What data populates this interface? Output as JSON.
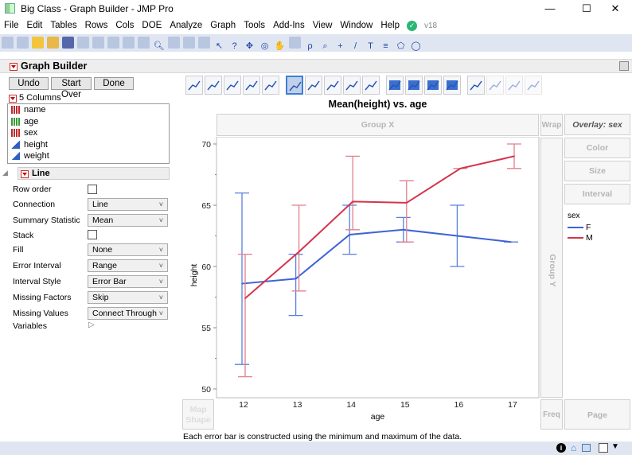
{
  "window": {
    "title": "Big Class - Graph Builder - JMP Pro",
    "minimize": "—",
    "maximize": "☐",
    "close": "✕"
  },
  "menu": [
    "File",
    "Edit",
    "Tables",
    "Rows",
    "Cols",
    "DOE",
    "Analyze",
    "Graph",
    "Tools",
    "Add-Ins",
    "View",
    "Window",
    "Help"
  ],
  "version": "v18",
  "toolbar_icons": [
    "new-table-icon",
    "new-script-icon",
    "python-icon",
    "open-icon",
    "save-icon",
    "cut-icon",
    "copy-icon",
    "paste-icon",
    "script-icon",
    "lock-icon",
    "search-icon",
    "data-grid-icon",
    "journal-icon",
    "add-icon",
    "arrow-icon",
    "help-icon",
    "crosshair-icon",
    "target-icon",
    "hand-icon",
    "brush-icon",
    "lasso-icon",
    "zoom-icon",
    "plus-icon",
    "line-icon",
    "text-icon",
    "annotate-icon",
    "polygon-icon",
    "oval-icon"
  ],
  "panel": {
    "title": "Graph Builder",
    "undo": "Undo",
    "start_over": "Start Over",
    "done": "Done",
    "columns_label": "5 Columns",
    "columns": [
      {
        "name": "name",
        "type": "nominal"
      },
      {
        "name": "age",
        "type": "ordinal"
      },
      {
        "name": "sex",
        "type": "nominal"
      },
      {
        "name": "height",
        "type": "continuous"
      },
      {
        "name": "weight",
        "type": "continuous"
      }
    ]
  },
  "line_section": {
    "title": "Line",
    "row_order": "Row order",
    "connection": "Connection",
    "connection_val": "Line",
    "summary": "Summary Statistic",
    "summary_val": "Mean",
    "stack": "Stack",
    "fill": "Fill",
    "fill_val": "None",
    "error_interval": "Error Interval",
    "error_interval_val": "Range",
    "interval_style": "Interval Style",
    "interval_style_val": "Error Bar",
    "missing_factors": "Missing Factors",
    "missing_factors_val": "Skip",
    "missing_values": "Missing Values",
    "missing_values_val": "Connect Through",
    "variables": "Variables"
  },
  "zones": {
    "group_x": "Group X",
    "wrap": "Wrap",
    "overlay": "Overlay: sex",
    "color": "Color",
    "size": "Size",
    "interval": "Interval",
    "group_y": "Group Y",
    "map_shape_1": "Map",
    "map_shape_2": "Shape",
    "freq": "Freq",
    "page": "Page"
  },
  "footnote": "Each error bar is constructed using the minimum and maximum of the data.",
  "colors": {
    "F": "#3d63d6",
    "M": "#d3354a",
    "F_bar": "#5a7fe0",
    "M_bar": "#e0808c"
  },
  "chart_data": {
    "type": "line",
    "title": "Mean(height) vs. age",
    "xlabel": "age",
    "ylabel": "height",
    "categories": [
      "12",
      "13",
      "14",
      "15",
      "16",
      "17"
    ],
    "ylim": [
      50,
      70.5
    ],
    "yticks": [
      "50",
      "55",
      "60",
      "65",
      "70"
    ],
    "legend": {
      "title": "sex",
      "position": "right"
    },
    "series": [
      {
        "name": "F",
        "values": [
          58.6,
          59.0,
          62.6,
          63.0,
          62.5,
          62.0
        ],
        "min": [
          52,
          56,
          61,
          62,
          60,
          62
        ],
        "max": [
          66,
          61,
          65,
          64,
          65,
          62
        ]
      },
      {
        "name": "M",
        "values": [
          57.4,
          61.2,
          65.3,
          65.2,
          68.0,
          69.0
        ],
        "min": [
          51,
          58,
          63,
          62,
          68,
          68
        ],
        "max": [
          61,
          65,
          69,
          67,
          68,
          70
        ]
      }
    ]
  }
}
